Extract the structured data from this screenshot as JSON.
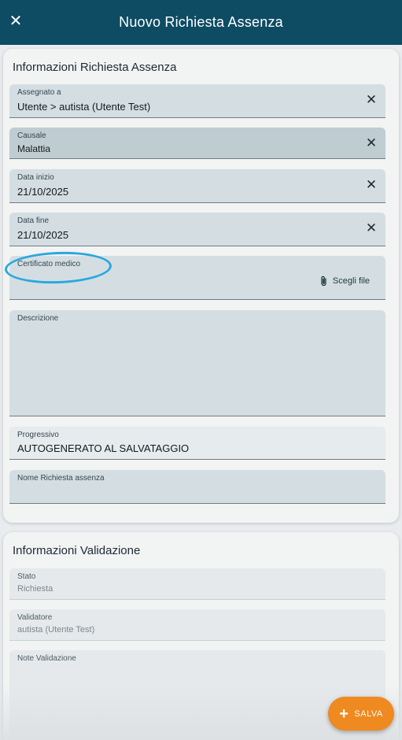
{
  "appbar": {
    "title": "Nuovo Richiesta Assenza",
    "close_icon": "close-icon"
  },
  "section1": {
    "title": "Informazioni Richiesta Assenza",
    "assegnato": {
      "label": "Assegnato a",
      "value": "Utente > autista (Utente Test)"
    },
    "causale": {
      "label": "Causale",
      "value": "Malattia"
    },
    "data_inizio": {
      "label": "Data inizio",
      "value": "21/10/2025"
    },
    "data_fine": {
      "label": "Data fine",
      "value": "21/10/2025"
    },
    "certificato": {
      "label": "Certificato medico",
      "button": "Scegli file"
    },
    "descrizione": {
      "label": "Descrizione",
      "value": ""
    },
    "progressivo": {
      "label": "Progressivo",
      "value": "AUTOGENERATO AL SALVATAGGIO"
    },
    "nome": {
      "label": "Nome Richiesta assenza",
      "value": ""
    }
  },
  "section2": {
    "title": "Informazioni Validazione",
    "stato": {
      "label": "Stato",
      "value": "Richiesta"
    },
    "validatore": {
      "label": "Validatore",
      "value": "autista (Utente Test)"
    },
    "note": {
      "label": "Note Validazione",
      "value": ""
    }
  },
  "fab": {
    "label": "SALVA"
  },
  "colors": {
    "primary": "#0d4c63",
    "accent": "#ee8a1f",
    "highlight": "#2aa8de"
  }
}
